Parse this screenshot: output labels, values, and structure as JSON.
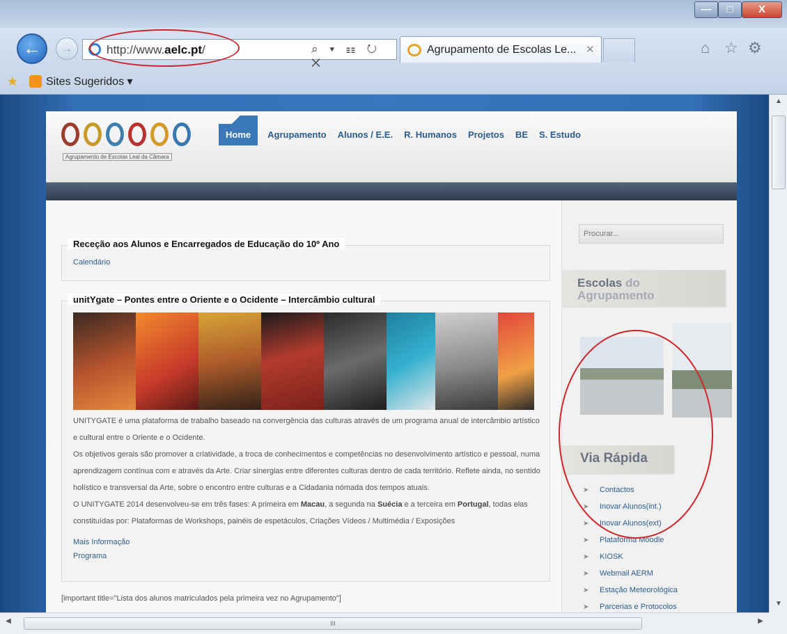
{
  "browser": {
    "window_buttons": {
      "minimize": "—",
      "maximize": "□",
      "close": "X"
    },
    "back_glyph": "←",
    "forward_glyph": "→",
    "url_plain": "http://www.",
    "url_bold": "aelc.pt",
    "url_suffix": "/",
    "address_icons": "⌕ ▾ ☷ ↻ ✕",
    "tab_title": "Agrupamento de Escolas Le...",
    "tab_close": "✕",
    "toolbar_icons": {
      "home": "⌂",
      "favorites": "☆",
      "tools": "⚙"
    },
    "favorites_bar": {
      "star": "★",
      "sites_label": "Sites Sugeridos ▾"
    }
  },
  "site": {
    "logo_caption": "Agrupamento de Escolas Leal da Câmara",
    "nav": [
      "Home",
      "Agrupamento",
      "Alunos / E.E.",
      "R. Humanos",
      "Projetos",
      "BE",
      "S. Estudo"
    ]
  },
  "posts": [
    {
      "title": "Receção aos Alunos e Encarregados de Educação do 10º Ano",
      "link": "Calendário"
    },
    {
      "title": "unitYgate – Pontes entre o Oriente e o Ocidente – Intercâmbio cultural",
      "p1": "UNITYGATE é uma plataforma de trabalho baseado na convergência das culturas através de um programa anual de intercâmbio artístico e cultural entre o Oriente e o Ocidente.",
      "p2": "Os objetivos gerais são promover a criatividade, a troca de conhecimentos e competências no desenvolvimento artístico e pessoal, numa aprendizagem contínua com e através da Arte. Criar sinergias entre diferentes culturas dentro de cada território. Reflete ainda, no sentido holístico e transversal da Arte, sobre o encontro entre culturas e a Cidadania nómada dos tempos atuais.",
      "p3_a": "O UNITYGATE 2014 desenvolveu-se em três fases: A primeira em ",
      "p3_b1": "Macau",
      "p3_c": ", a segunda na ",
      "p3_b2": "Suécia",
      "p3_d": " e a terceira em ",
      "p3_b3": "Portugal",
      "p3_e": ", todas elas constituídas por: Plataformas de Workshops, painéis de espetáculos, Criações Vídeos / Multimédia / Exposições",
      "link1": "Mais Informação",
      "link2": "Programa"
    }
  ],
  "important_text": "[important title=\"Lista dos alunos matriculados pela primeira vez no Agrupamento\"]",
  "sidebar": {
    "search_placeholder": "Procurar...",
    "escolas_strong": "Escolas",
    "escolas_light": " do",
    "escolas_line2": "Agrupamento",
    "via_heading": "Via Rápida",
    "quick_links": [
      "Contactos",
      "Inovar Alunos(int.)",
      "Inovar Alunos(ext)",
      "Plataforma Moodle",
      "KIOSK",
      "Webmail AERM",
      "Estação Meteorológica",
      "Parcerias e Protocolos"
    ],
    "arrow_glyph": "➤"
  },
  "scrollbar": {
    "up": "▲",
    "down": "▼",
    "left": "◀",
    "right": "▶",
    "grip": "III"
  },
  "colors": {
    "annotation_red": "#d1242a",
    "nav_active": "#3b78b8",
    "link": "#2c5c8f"
  }
}
